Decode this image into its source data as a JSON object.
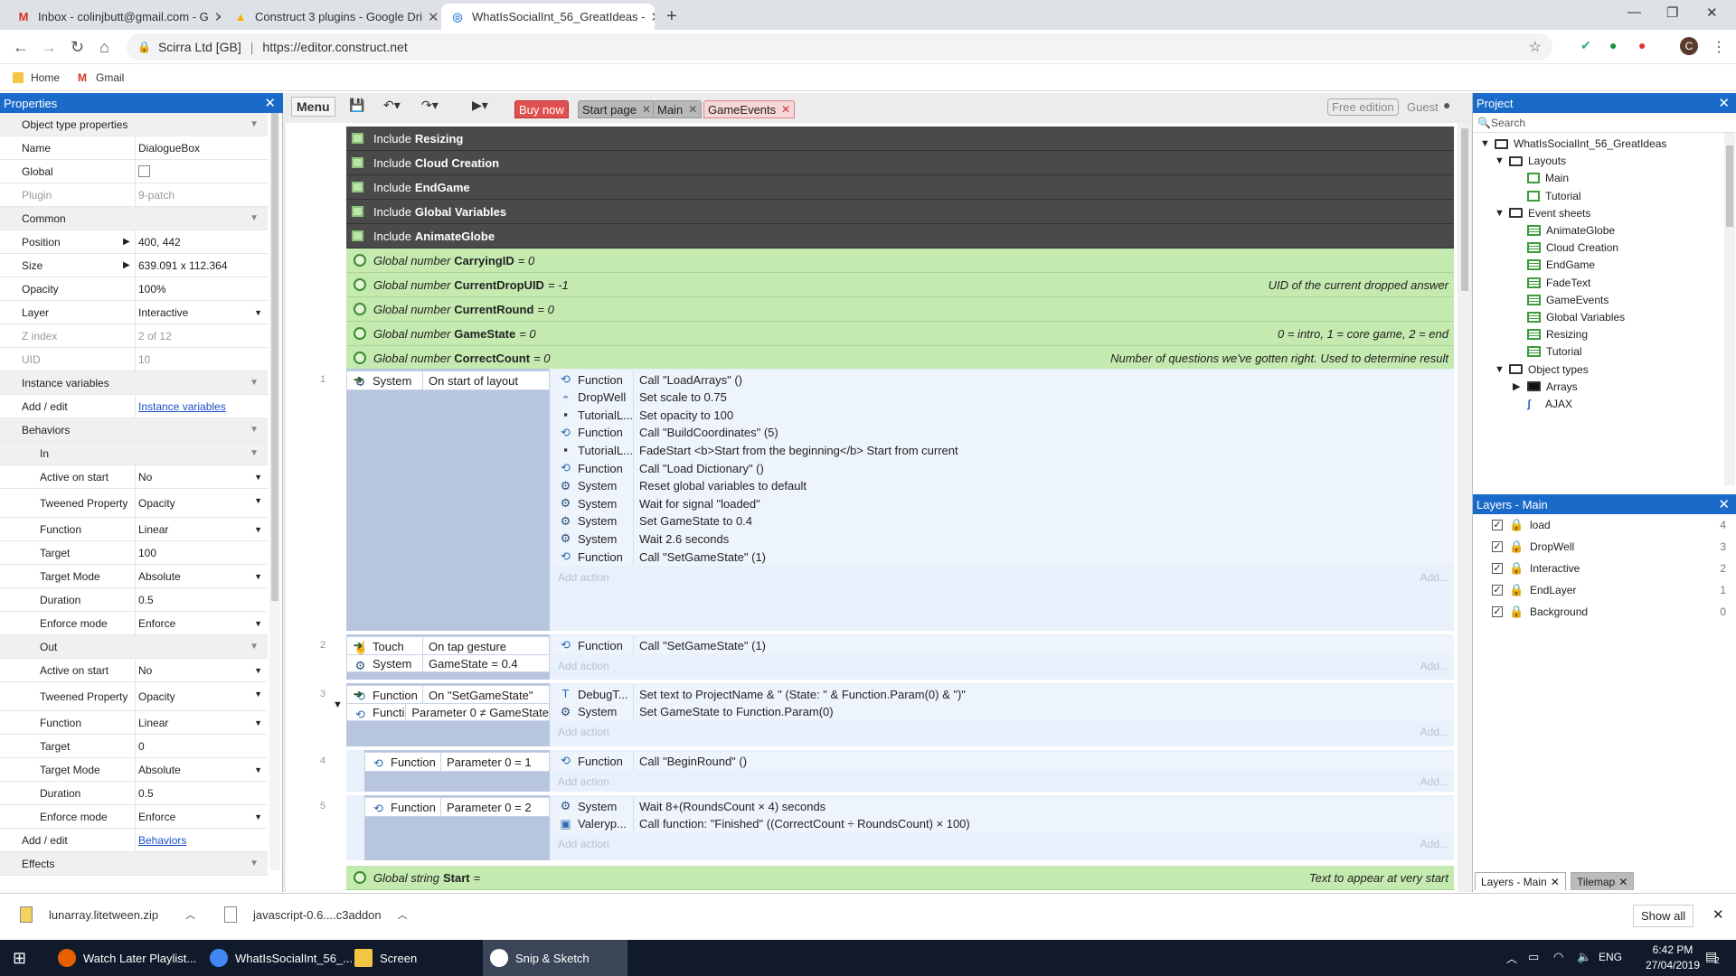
{
  "browser": {
    "tabs": [
      {
        "title": "Inbox - colinjbutt@gmail.com - G",
        "icon": "gmail-icon"
      },
      {
        "title": "Construct 3 plugins - Google Dri",
        "icon": "google-drive-icon"
      },
      {
        "title": "WhatIsSocialInt_56_GreatIdeas - ",
        "icon": "construct-icon"
      }
    ],
    "site_label": "Scirra Ltd [GB]",
    "url": "https://editor.construct.net",
    "bookmarks": [
      "Home",
      "Gmail"
    ],
    "profile": "C"
  },
  "properties": {
    "title": "Properties",
    "rows": [
      {
        "label": "Object type properties",
        "type": "section"
      },
      {
        "label": "Name",
        "value": "DialogueBox"
      },
      {
        "label": "Global",
        "type": "checkbox"
      },
      {
        "label": "Plugin",
        "value": "9-patch",
        "disabled": true
      },
      {
        "label": "Common",
        "type": "section"
      },
      {
        "label": "Position",
        "value": "400, 442",
        "expand": true
      },
      {
        "label": "Size",
        "value": "639.091 x 112.364",
        "expand": true
      },
      {
        "label": "Opacity",
        "value": "100%"
      },
      {
        "label": "Layer",
        "value": "Interactive",
        "dropdown": true
      },
      {
        "label": "Z index",
        "value": "2 of 12",
        "disabled": true
      },
      {
        "label": "UID",
        "value": "10",
        "disabled": true
      },
      {
        "label": "Instance variables",
        "type": "section"
      },
      {
        "label": "Add / edit",
        "value": "Instance variables",
        "link": true
      },
      {
        "label": "Behaviors",
        "type": "section"
      },
      {
        "label": "In",
        "type": "subsection"
      },
      {
        "label": "Active on start",
        "value": "No",
        "dropdown": true,
        "indent": true
      },
      {
        "label": "Tweened Property",
        "value": "Opacity",
        "dropdown": true,
        "indent": true,
        "tall": true
      },
      {
        "label": "Function",
        "value": "Linear",
        "dropdown": true,
        "indent": true
      },
      {
        "label": "Target",
        "value": "100",
        "indent": true
      },
      {
        "label": "Target Mode",
        "value": "Absolute",
        "dropdown": true,
        "indent": true
      },
      {
        "label": "Duration",
        "value": "0.5",
        "indent": true
      },
      {
        "label": "Enforce mode",
        "value": "Enforce",
        "dropdown": true,
        "indent": true
      },
      {
        "label": "Out",
        "type": "subsection"
      },
      {
        "label": "Active on start",
        "value": "No",
        "dropdown": true,
        "indent": true
      },
      {
        "label": "Tweened Property",
        "value": "Opacity",
        "dropdown": true,
        "indent": true,
        "tall": true
      },
      {
        "label": "Function",
        "value": "Linear",
        "dropdown": true,
        "indent": true
      },
      {
        "label": "Target",
        "value": "0",
        "indent": true
      },
      {
        "label": "Target Mode",
        "value": "Absolute",
        "dropdown": true,
        "indent": true
      },
      {
        "label": "Duration",
        "value": "0.5",
        "indent": true
      },
      {
        "label": "Enforce mode",
        "value": "Enforce",
        "dropdown": true,
        "indent": true
      },
      {
        "label": "Add / edit",
        "value": "Behaviors",
        "link": true
      },
      {
        "label": "Effects",
        "type": "section"
      }
    ]
  },
  "toolbar": {
    "menu": "Menu",
    "tabs": [
      {
        "label": "Buy now",
        "style": "buy"
      },
      {
        "label": "Start page",
        "style": "gray"
      },
      {
        "label": "Main",
        "style": "gray"
      },
      {
        "label": "GameEvents",
        "style": "active"
      }
    ],
    "free_edition": "Free edition",
    "guest": "Guest"
  },
  "events": {
    "includes": [
      "Resizing",
      "Cloud Creation",
      "EndGame",
      "Global Variables",
      "AnimateGlobe"
    ],
    "include_word": "Include",
    "globals": [
      {
        "kind": "Global number",
        "name": "CarryingID",
        "value": "= 0",
        "comment": ""
      },
      {
        "kind": "Global number",
        "name": "CurrentDropUID",
        "value": "= -1",
        "comment": "UID of the current dropped answer"
      },
      {
        "kind": "Global number",
        "name": "CurrentRound",
        "value": "= 0",
        "comment": ""
      },
      {
        "kind": "Global number",
        "name": "GameState",
        "value": "= 0",
        "comment": "0 = intro, 1 = core game, 2 = end"
      },
      {
        "kind": "Global number",
        "name": "CorrectCount",
        "value": "= 0",
        "comment": "Number of questions we've gotten right. Used to determine result"
      }
    ],
    "add_action": "Add action",
    "add": "Add...",
    "ev1": {
      "num": "1",
      "conds": [
        {
          "obj": "System",
          "text": "On start of layout"
        }
      ],
      "actions": [
        {
          "obj": "Function",
          "text": "Call \"LoadArrays\" ()"
        },
        {
          "obj": "DropWell",
          "text": "Set scale to 0.75"
        },
        {
          "obj": "TutorialL...",
          "text": "Set opacity to 100"
        },
        {
          "obj": "Function",
          "text": "Call \"BuildCoordinates\" (5)"
        },
        {
          "obj": "TutorialL...",
          "text": "FadeStart <b>Start from the beginning</b> Start from current"
        },
        {
          "obj": "Function",
          "text": "Call \"Load Dictionary\" ()"
        },
        {
          "obj": "System",
          "text": "Reset global variables to default"
        },
        {
          "obj": "System",
          "text": "Wait for signal \"loaded\""
        },
        {
          "obj": "System",
          "text": "Set GameState to 0.4"
        },
        {
          "obj": "System",
          "text": "Wait 2.6 seconds"
        },
        {
          "obj": "Function",
          "text": "Call \"SetGameState\" (1)"
        }
      ]
    },
    "ev2": {
      "num": "2",
      "conds": [
        {
          "obj": "Touch",
          "text": "On tap gesture"
        },
        {
          "obj": "System",
          "text": "GameState = 0.4"
        }
      ],
      "actions": [
        {
          "obj": "Function",
          "text": "Call \"SetGameState\" (1)"
        }
      ]
    },
    "ev3": {
      "num": "3",
      "conds": [
        {
          "obj": "Function",
          "text": "On \"SetGameState\""
        },
        {
          "obj": "Function",
          "text": "Parameter 0 ≠ GameState"
        }
      ],
      "actions": [
        {
          "obj": "DebugT...",
          "text": "Set text to ProjectName & \" (State: \" & Function.Param(0) & \")\""
        },
        {
          "obj": "System",
          "text": "Set GameState to Function.Param(0)"
        }
      ]
    },
    "ev4": {
      "num": "4",
      "conds": [
        {
          "obj": "Function",
          "text": "Parameter 0 = 1"
        }
      ],
      "actions": [
        {
          "obj": "Function",
          "text": "Call \"BeginRound\" ()"
        }
      ]
    },
    "ev5": {
      "num": "5",
      "conds": [
        {
          "obj": "Function",
          "text": "Parameter 0 = 2"
        }
      ],
      "actions": [
        {
          "obj": "System",
          "text": "Wait 8+(RoundsCount × 4) seconds"
        },
        {
          "obj": "Valeryp...",
          "text": "Call function: \"Finished\" ((CorrectCount ÷ RoundsCount) × 100)"
        }
      ]
    },
    "last_global": {
      "kind": "Global string",
      "name": "Start",
      "value": "=",
      "comment": "Text to appear at very start"
    }
  },
  "project": {
    "title": "Project",
    "search_placeholder": "Search",
    "root": "WhatIsSocialInt_56_GreatIdeas",
    "layouts_label": "Layouts",
    "layouts": [
      "Main",
      "Tutorial"
    ],
    "eventsheets_label": "Event sheets",
    "eventsheets": [
      "AnimateGlobe",
      "Cloud Creation",
      "EndGame",
      "FadeText",
      "GameEvents",
      "Global Variables",
      "Resizing",
      "Tutorial"
    ],
    "objtypes_label": "Object types",
    "objtypes": [
      "Arrays",
      "AJAX"
    ]
  },
  "layers": {
    "title": "Layers - Main",
    "items": [
      {
        "name": "load",
        "num": "4"
      },
      {
        "name": "DropWell",
        "num": "3"
      },
      {
        "name": "Interactive",
        "num": "2"
      },
      {
        "name": "EndLayer",
        "num": "1"
      },
      {
        "name": "Background",
        "num": "0"
      }
    ],
    "bottom_tabs": [
      "Layers - Main",
      "Tilemap"
    ]
  },
  "downloads": {
    "items": [
      "lunarray.litetween.zip",
      "javascript-0.6....c3addon"
    ],
    "show_all": "Show all"
  },
  "taskbar": {
    "items": [
      "Watch Later Playlist...",
      "WhatIsSocialInt_56_...",
      "Screen",
      "Snip & Sketch"
    ],
    "lang": "ENG",
    "time": "6:42 PM",
    "date": "27/04/2019",
    "notif": "2"
  }
}
